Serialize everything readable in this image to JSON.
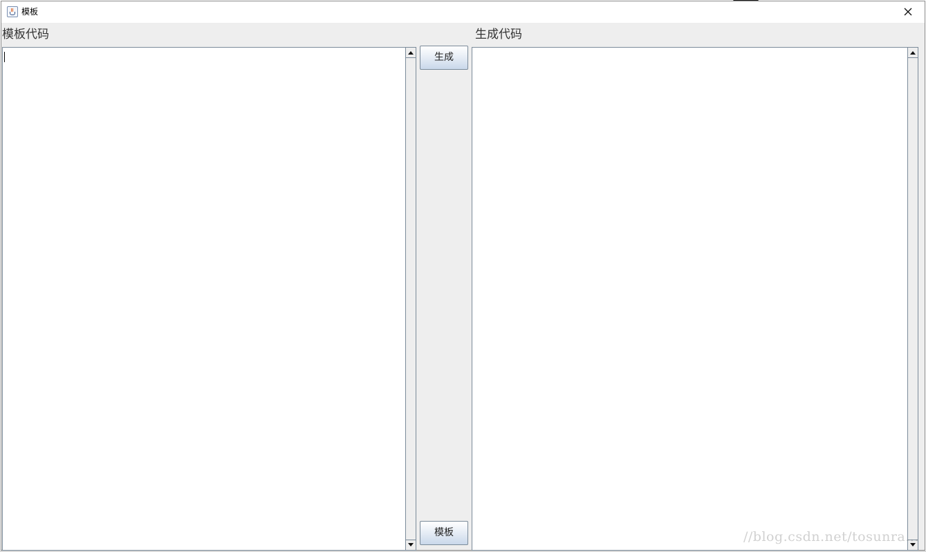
{
  "window": {
    "title": "模板",
    "icon": "java-cup-icon",
    "close_icon": "close-icon"
  },
  "left_panel": {
    "label": "模板代码",
    "content": ""
  },
  "right_panel": {
    "label": "生成代码",
    "content": ""
  },
  "buttons": {
    "generate_label": "生成",
    "template_label": "模板"
  },
  "watermark": {
    "text": "//blog.csdn.net/tosunra..."
  },
  "colors": {
    "window_bg": "#eeeeee",
    "text_area_bg": "#ffffff",
    "border": "#7a8a99"
  }
}
